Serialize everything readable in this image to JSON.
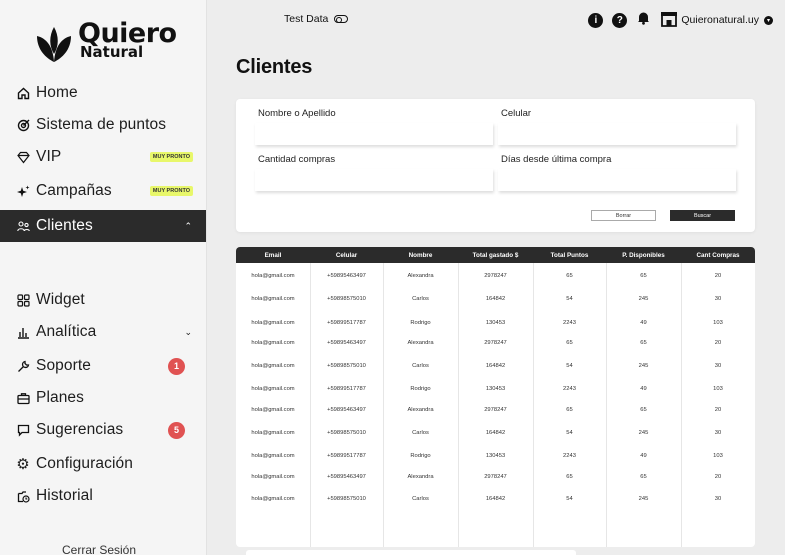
{
  "brand": {
    "line1": "Quiero",
    "line2": "Natural"
  },
  "nav": {
    "items": [
      {
        "label": "Home",
        "icon": "home-icon"
      },
      {
        "label": "Sistema de puntos",
        "icon": "target-icon"
      },
      {
        "label": "VIP",
        "icon": "diamond-icon",
        "tag": "MUY PRONTO"
      },
      {
        "label": "Campañas",
        "icon": "sparkle-icon",
        "tag": "MUY PRONTO"
      },
      {
        "label": "Clientes",
        "icon": "users-icon",
        "active": true
      },
      {
        "label": "Widget",
        "icon": "widget-grid-icon"
      },
      {
        "label": "Analítica",
        "icon": "bar-chart-icon"
      },
      {
        "label": "Soporte",
        "icon": "wrench-icon",
        "badge": "1"
      },
      {
        "label": "Planes",
        "icon": "briefcase-icon"
      },
      {
        "label": "Sugerencias",
        "icon": "comment-icon",
        "badge": "5"
      },
      {
        "label": "Configuración",
        "icon": "gear-icon"
      },
      {
        "label": "Historial",
        "icon": "history-icon"
      }
    ],
    "logout": "Cerrar Sesión"
  },
  "topbar": {
    "test_data_label": "Test Data",
    "store_name": "Quieronatural.uy"
  },
  "page": {
    "title": "Clientes"
  },
  "filters": {
    "name_label": "Nombre o Apellido",
    "phone_label": "Celular",
    "purchases_label": "Cantidad compras",
    "days_label": "Días desde última compra",
    "clear_label": "Borrar",
    "search_label": "Buscar"
  },
  "table": {
    "columns": [
      "Email",
      "Celular",
      "Nombre",
      "Total gastado $",
      "Total Puntos",
      "P. Disponibles",
      "Cant Compras"
    ],
    "rows": [
      [
        "hola@gmail.com",
        "+59895463497",
        "Alexandra",
        "2978247",
        "65",
        "65",
        "20"
      ],
      [
        "hola@gmail.com",
        "+59898575010",
        "Carlos",
        "164842",
        "54",
        "245",
        "30"
      ],
      [
        "hola@gmail.com",
        "+59899517787",
        "Rodrigo",
        "130453",
        "2243",
        "49",
        "103"
      ],
      [
        "hola@gmail.com",
        "+59895463497",
        "Alexandra",
        "2978247",
        "65",
        "65",
        "20"
      ],
      [
        "hola@gmail.com",
        "+59898575010",
        "Carlos",
        "164842",
        "54",
        "245",
        "30"
      ],
      [
        "hola@gmail.com",
        "+59899517787",
        "Rodrigo",
        "130453",
        "2243",
        "49",
        "103"
      ],
      [
        "hola@gmail.com",
        "+59895463497",
        "Alexandra",
        "2978247",
        "65",
        "65",
        "20"
      ],
      [
        "hola@gmail.com",
        "+59898575010",
        "Carlos",
        "164842",
        "54",
        "245",
        "30"
      ],
      [
        "hola@gmail.com",
        "+59899517787",
        "Rodrigo",
        "130453",
        "2243",
        "49",
        "103"
      ],
      [
        "hola@gmail.com",
        "+59895463497",
        "Alexandra",
        "2978247",
        "65",
        "65",
        "20"
      ],
      [
        "hola@gmail.com",
        "+59898575010",
        "Carlos",
        "164842",
        "54",
        "245",
        "30"
      ]
    ]
  },
  "colors": {
    "dark": "#2b2b2b",
    "tag": "#e8f76a",
    "badge": "#e05252"
  }
}
